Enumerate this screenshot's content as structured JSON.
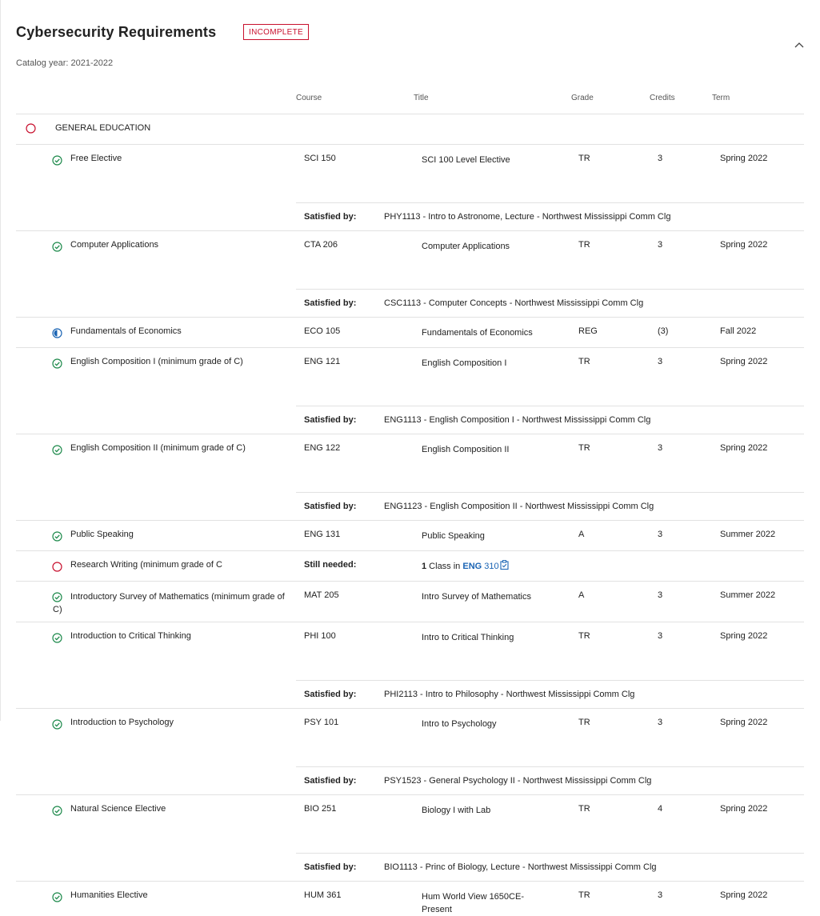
{
  "header": {
    "title": "Cybersecurity Requirements",
    "status_badge": "INCOMPLETE",
    "catalog": "Catalog year:  2021-2022"
  },
  "columns": {
    "course": "Course",
    "title": "Title",
    "grade": "Grade",
    "credits": "Credits",
    "term": "Term"
  },
  "section": {
    "name": "GENERAL EDUCATION",
    "status_icon": "circle-outline-icon"
  },
  "labels": {
    "satisfied_by": "Satisfied by:",
    "still_needed": "Still needed:"
  },
  "requirements": [
    {
      "name": "Free Elective",
      "status": "check-circle-icon",
      "course": "SCI 150",
      "title": "SCI 100 Level Elective",
      "grade": "TR",
      "credits": "3",
      "term": "Spring 2022",
      "satisfied_by": "PHY1113 - Intro to Astronome, Lecture - Northwest Mississippi Comm Clg"
    },
    {
      "name": "Computer Applications",
      "status": "check-circle-icon",
      "course": "CTA 206",
      "title": "Computer Applications",
      "grade": "TR",
      "credits": "3",
      "term": "Spring 2022",
      "satisfied_by": "CSC1113 - Computer Concepts - Northwest Mississippi Comm Clg"
    },
    {
      "name": "Fundamentals of Economics",
      "status": "in-progress-icon",
      "course": "ECO 105",
      "title": "Fundamentals of Economics",
      "grade": "REG",
      "credits": "(3)",
      "term": "Fall 2022"
    },
    {
      "name": "English Composition I (minimum grade of C)",
      "status": "check-circle-icon",
      "course": "ENG 121",
      "title": "English Composition I",
      "grade": "TR",
      "credits": "3",
      "term": "Spring 2022",
      "satisfied_by": "ENG1113 - English Composition I - Northwest Mississippi Comm Clg"
    },
    {
      "name": "English Composition II (minimum grade of C)",
      "status": "check-circle-icon",
      "course": "ENG 122",
      "title": "English Composition II",
      "grade": "TR",
      "credits": "3",
      "term": "Spring 2022",
      "satisfied_by": "ENG1123 - English Composition II - Northwest Mississippi Comm Clg"
    },
    {
      "name": "Public Speaking",
      "status": "check-circle-icon",
      "course": "ENG 131",
      "title": "Public Speaking",
      "grade": "A",
      "credits": "3",
      "term": "Summer 2022"
    },
    {
      "name": "Research Writing (minimum grade of C",
      "status": "circle-outline-icon",
      "still_needed": {
        "count": "1",
        "text": "Class in",
        "subject": "ENG",
        "number": "310",
        "icon": "clipboard-check-icon"
      }
    },
    {
      "name": "Introductory Survey of Mathematics (minimum grade of C)",
      "status": "check-circle-icon",
      "course": "MAT 205",
      "title": "Intro Survey of Mathematics",
      "grade": "A",
      "credits": "3",
      "term": "Summer 2022"
    },
    {
      "name": "Introduction to Critical Thinking",
      "status": "check-circle-icon",
      "course": "PHI 100",
      "title": "Intro to Critical Thinking",
      "grade": "TR",
      "credits": "3",
      "term": "Spring 2022",
      "satisfied_by": "PHI2113 - Intro to Philosophy - Northwest Mississippi Comm Clg"
    },
    {
      "name": "Introduction to Psychology",
      "status": "check-circle-icon",
      "course": "PSY 101",
      "title": "Intro to Psychology",
      "grade": "TR",
      "credits": "3",
      "term": "Spring 2022",
      "satisfied_by": "PSY1523 - General Psychology II - Northwest Mississippi Comm Clg"
    },
    {
      "name": "Natural Science Elective",
      "status": "check-circle-icon",
      "course": "BIO 251",
      "title": "Biology I with Lab",
      "grade": "TR",
      "credits": "4",
      "term": "Spring 2022",
      "satisfied_by": "BIO1113 - Princ of Biology, Lecture - Northwest Mississippi Comm Clg"
    },
    {
      "name": "Humanities Elective",
      "status": "check-circle-icon",
      "course": "HUM 361",
      "title": "Hum World View 1650CE-Present",
      "grade": "TR",
      "credits": "3",
      "term": "Spring 2022"
    }
  ],
  "colors": {
    "complete": "#1e8a4c",
    "incomplete": "#c8102e",
    "in_progress": "#1a64b4",
    "link": "#1a64b4"
  }
}
